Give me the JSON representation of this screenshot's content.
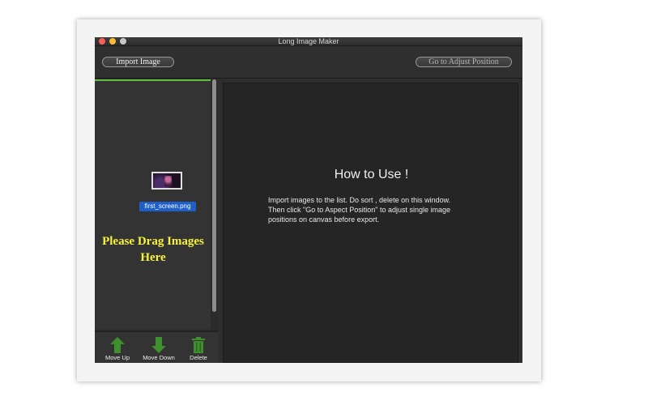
{
  "window": {
    "title": "Long Image Maker"
  },
  "toolbar": {
    "import_label": "Import Image",
    "adjust_label": "Go to Adjust Position"
  },
  "list": {
    "file_name": "first_screen.png",
    "drag_hint_line1": "Please Drag Images",
    "drag_hint_line2": "Here"
  },
  "bottom_actions": {
    "move_up": "Move Up",
    "move_down": "Move Down",
    "delete": "Delete"
  },
  "help": {
    "title": "How to Use !",
    "line1": "Import images to the list.  Do sort , delete on this window.",
    "line2": "Then click \"Go to Aspect Position\" to adjust single image",
    "line3": "positions on canvas before export."
  },
  "colors": {
    "accent_green": "#5fbf3a",
    "hint_yellow": "#f7f23c",
    "selection_blue": "#1f5fc9",
    "arrow_green": "#3f8f2e"
  },
  "icons": {
    "move_up": "arrow-up-icon",
    "move_down": "arrow-down-icon",
    "delete": "trash-icon"
  }
}
